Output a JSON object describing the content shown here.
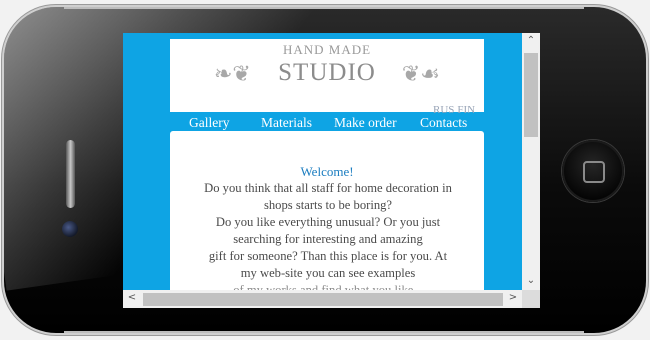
{
  "header": {
    "logo_top": "HAND MADE",
    "logo_main": "STUDIO",
    "ornament_left": "❧❦",
    "ornament_right": "❦☙",
    "lang": [
      "RUS",
      "FIN"
    ]
  },
  "nav": [
    "Gallery",
    "Materials",
    "Make order",
    "Contacts"
  ],
  "content": {
    "welcome": "Welcome!",
    "lines": [
      "Do you think that all staff for home decoration in",
      "shops starts to be boring?",
      "Do you like everything unusual? Or you just",
      "searching for interesting and amazing",
      "gift for someone? Than this place is for you. At",
      "my web-site you can see examples",
      "of my works and find what you like..."
    ]
  },
  "scroll": {
    "up_icon": "⌃",
    "down_icon": "⌄",
    "left_icon": "<",
    "right_icon": ">"
  },
  "colors": {
    "accent": "#0ea4e4",
    "welcome": "#1b7dc0"
  }
}
